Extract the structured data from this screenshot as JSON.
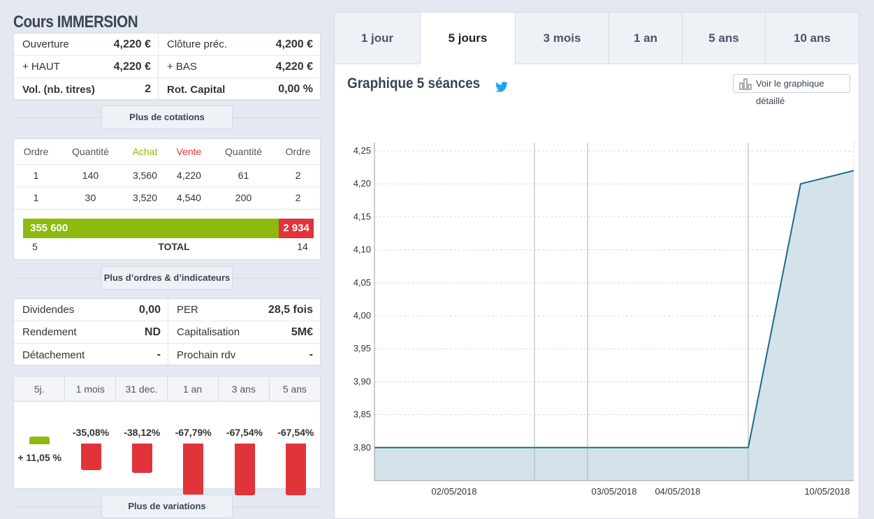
{
  "page_title": "Cours IMMERSION",
  "quote": [
    {
      "l1": "Ouverture",
      "v1": "4,220 €",
      "l2": "Clôture préc.",
      "v2": "4,200 €"
    },
    {
      "l1": "+ HAUT",
      "v1": "4,220 €",
      "l2": "+ BAS",
      "v2": "4,220 €"
    },
    {
      "l1": "Vol. (nb. titres)",
      "v1": "2",
      "l2": "Rot. Capital",
      "v2": "0,00 %"
    }
  ],
  "buttons": {
    "more_quotes": "Plus de cotations",
    "more_orders": "Plus d’ordres & d’indicateurs",
    "more_variations": "Plus de variations",
    "detailed_chart": "Voir le graphique détaillé"
  },
  "orderbook": {
    "headers": [
      "Ordre",
      "Quantité",
      "Achat",
      "Vente",
      "Quantité",
      "Ordre"
    ],
    "rows": [
      [
        "1",
        "140",
        "3,560",
        "4,220",
        "61",
        "2"
      ],
      [
        "1",
        "30",
        "3,520",
        "4,540",
        "200",
        "2"
      ]
    ],
    "total_buy": "355 600",
    "total_sell": "2 934",
    "buy_share": 0.9918,
    "orders_buy": "5",
    "total_label": "TOTAL",
    "orders_sell": "14"
  },
  "indicators": [
    {
      "l1": "Dividendes",
      "v1": "0,00",
      "l2": "PER",
      "v2": "28,5 fois"
    },
    {
      "l1": "Rendement",
      "v1": "ND",
      "l2": "Capitalisation",
      "v2": "5M€"
    },
    {
      "l1": "Détachement",
      "v1": "-",
      "l2": "Prochain rdv",
      "v2": "-"
    }
  ],
  "variations": {
    "periods": [
      "5j.",
      "1 mois",
      "31 dec.",
      "1 an",
      "3 ans",
      "5 ans"
    ],
    "values": [
      11.05,
      -35.08,
      -38.12,
      -67.79,
      -67.54,
      -67.54
    ],
    "labels": [
      "+ 11,05 %",
      "-35,08%",
      "-38,12%",
      "-67,79%",
      "-67,54%",
      "-67,54%"
    ]
  },
  "tabs": [
    "1 jour",
    "5 jours",
    "3 mois",
    "1 an",
    "5 ans",
    "10 ans"
  ],
  "active_tab": "5 jours",
  "chart_title": "Graphique 5 séances",
  "chart_data": {
    "type": "area",
    "title": "Graphique 5 séances",
    "x": [
      "02/05/2018",
      "03/05/2018",
      "04/05/2018",
      "10/05/2018"
    ],
    "x_labels": [
      "02/05/2018",
      "03/05/2018",
      "04/05/2018",
      "10/05/2018"
    ],
    "y_ticks": [
      "4,25",
      "4,20",
      "4,15",
      "4,10",
      "4,05",
      "4,00",
      "3,95",
      "3,90",
      "3,85",
      "3,80"
    ],
    "ylim": [
      3.75,
      4.25
    ],
    "series": [
      {
        "points": [
          [
            "02/05/2018",
            3.8
          ],
          [
            "03/05/2018",
            3.8
          ],
          [
            "04/05/2018",
            3.8
          ],
          [
            "10/05/2018 open",
            4.2
          ],
          [
            "10/05/2018 close",
            4.22
          ]
        ]
      }
    ],
    "colors": {
      "line": "#1c6a8a",
      "fill": "#cfe0e8"
    },
    "grid": true
  }
}
